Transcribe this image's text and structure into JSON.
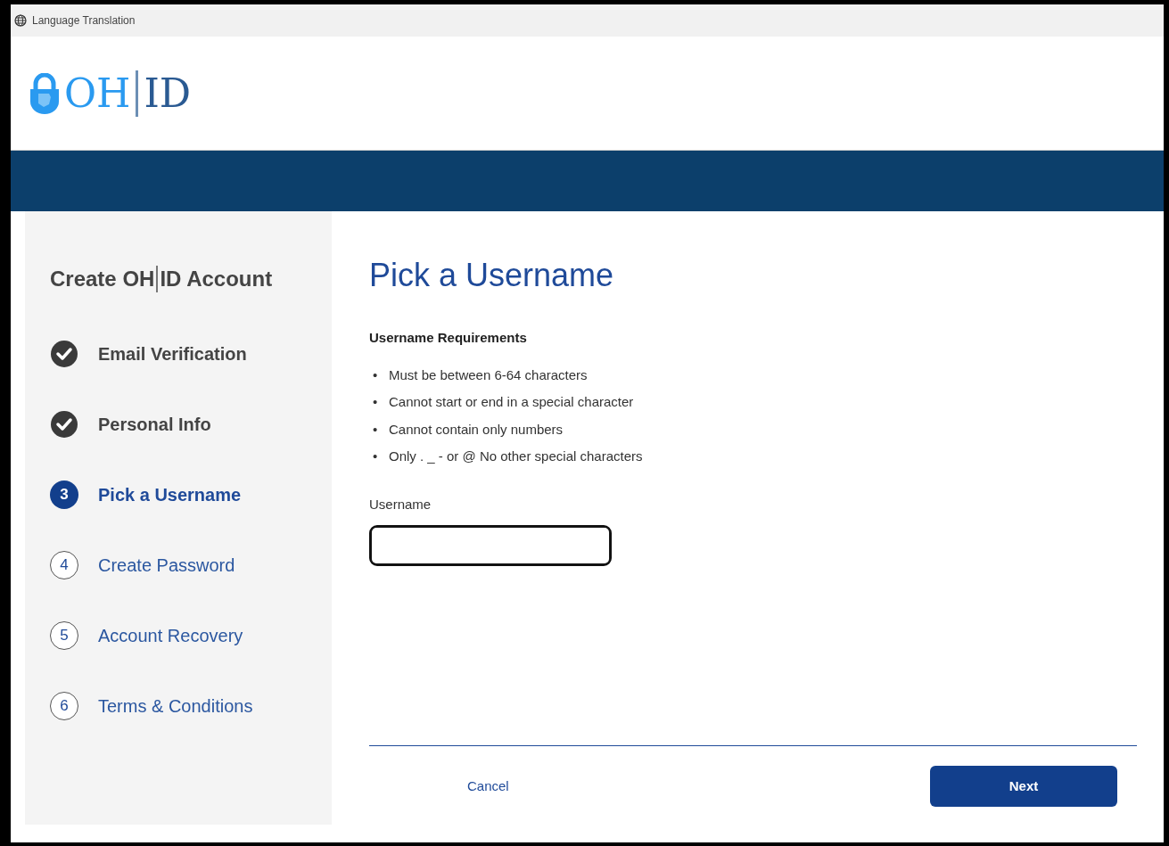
{
  "topbar": {
    "label": "Language Translation"
  },
  "logo": {
    "left": "OH",
    "right": "ID"
  },
  "sidebar": {
    "title_parts": [
      "Create OH",
      "ID Account"
    ],
    "steps": [
      {
        "label": "Email Verification",
        "completed": true,
        "selected": false
      },
      {
        "label": "Personal Info",
        "completed": true,
        "selected": false
      },
      {
        "label": "Pick a Username",
        "number": "3",
        "completed": false,
        "selected": true
      },
      {
        "label": "Create Password",
        "number": "4",
        "completed": false,
        "selected": false
      },
      {
        "label": "Account Recovery",
        "number": "5",
        "completed": false,
        "selected": false
      },
      {
        "label": "Terms & Conditions",
        "number": "6",
        "completed": false,
        "selected": false
      }
    ]
  },
  "main": {
    "heading": "Pick a Username",
    "requirements_title": "Username Requirements",
    "requirements": [
      {
        "bullet": "•",
        "text": "Must be between 6-64 characters"
      },
      {
        "bullet": "•",
        "text": "Cannot start or end in a special character"
      },
      {
        "bullet": "•",
        "text": "Cannot contain only numbers"
      },
      {
        "bullet": "•",
        "text": "Only . _ - or @ No other special characters"
      }
    ],
    "field": {
      "label": "Username",
      "focused": true
    },
    "buttons": {
      "cancel": "Cancel",
      "next": "Next"
    }
  }
}
